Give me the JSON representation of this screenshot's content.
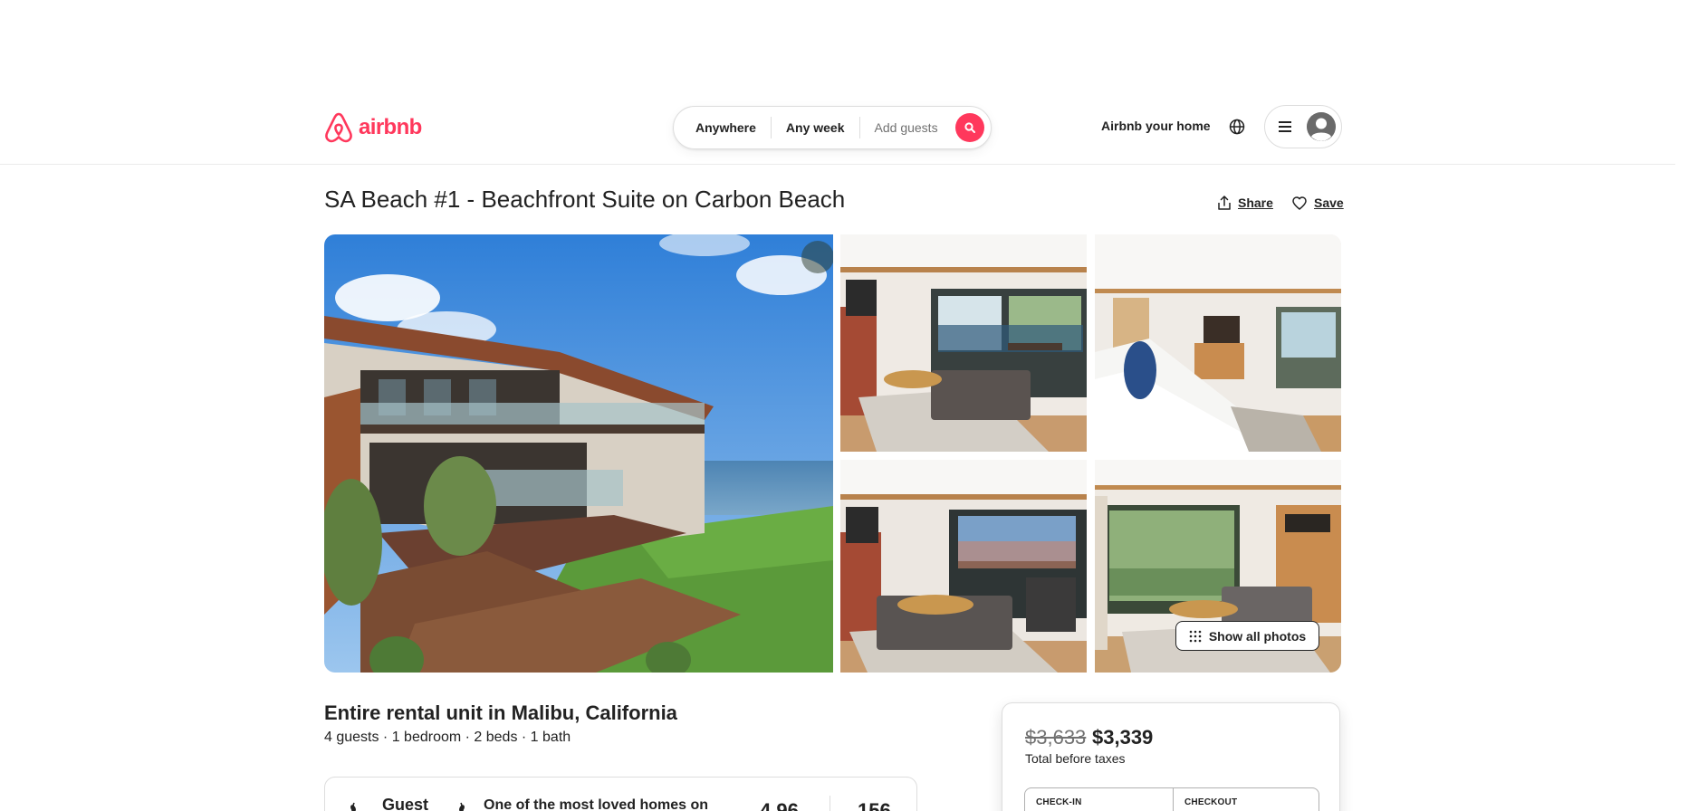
{
  "brand": {
    "name": "airbnb",
    "color": "#ff385c"
  },
  "search": {
    "location": "Anywhere",
    "dates": "Any week",
    "guests_placeholder": "Add guests"
  },
  "nav": {
    "host_link": "Airbnb your home"
  },
  "listing": {
    "title": "SA Beach #1 - Beachfront Suite on Carbon Beach",
    "share_label": "Share",
    "save_label": "Save",
    "show_all_photos": "Show all photos",
    "type_location": "Entire rental unit in Malibu, California",
    "details": "4 guests · 1 bedroom · 2 beds · 1 bath"
  },
  "guest_favorite": {
    "label": "Guest",
    "text": "One of the most loved homes on",
    "rating": "4.96",
    "reviews": "156"
  },
  "booking": {
    "original_price": "$3,633",
    "price": "$3,339",
    "price_note": "Total before taxes",
    "checkin_label": "CHECK-IN",
    "checkout_label": "CHECKOUT"
  },
  "icons": {
    "search": "search-icon",
    "globe": "globe-icon",
    "menu": "hamburger-menu-icon",
    "avatar": "user-avatar-icon",
    "share": "share-icon",
    "save": "heart-icon",
    "grid": "grid-dots-icon",
    "laurel": "laurel-icon"
  }
}
